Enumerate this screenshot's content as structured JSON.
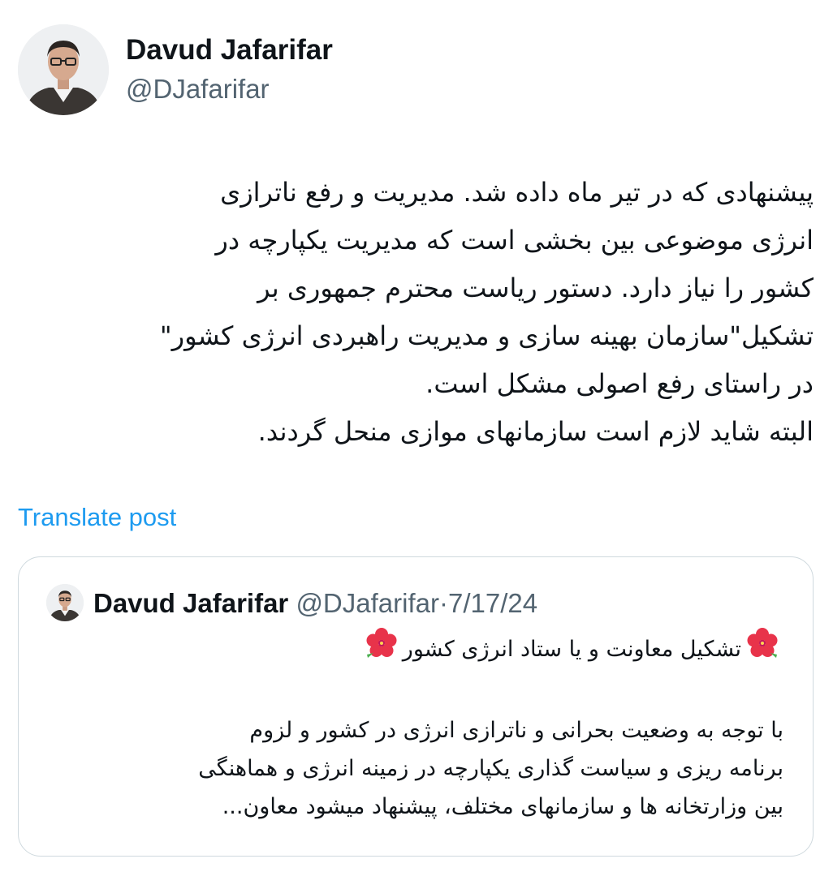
{
  "author": {
    "display_name": "Davud Jafarifar",
    "handle": "@DJafarifar"
  },
  "post": {
    "lines": [
      "پیشنهادی که در  تیر ماه داده شد. مدیریت و رفع ناترازی",
      "انرژی موضوعی بین بخشی است که مدیریت یکپارچه در",
      "کشور را نیاز دارد. دستور ریاست محترم جمهوری بر",
      "تشکیل\"سازمان بهینه سازی و مدیریت راهبردی انرژی کشور\"",
      "در راستای رفع اصولی مشکل است.",
      "البته شاید لازم است سازمانهای موازی منحل گردند."
    ],
    "translate_label": "Translate post"
  },
  "quoted_post": {
    "display_name": "Davud Jafarifar",
    "handle": "@DJafarifar",
    "separator": "·",
    "date": "7/17/24",
    "title": "تشکیل معاونت  و یا ستاد انرژی کشور",
    "title_emoji": "hibiscus-flower-icon",
    "body_lines": [
      "با توجه به وضعیت بحرانی و ناترازی انرژی در کشور و  لزوم",
      "برنامه ریزی و سیاست گذاری یکپارچه در زمینه انرژی و هماهنگی",
      "بین وزارتخانه ها و سازمانهای مختلف، پیشنهاد میشود معاون..."
    ]
  },
  "colors": {
    "text": "#0f1419",
    "secondary_text": "#536471",
    "link": "#1d9bf0",
    "card_border": "#cfd9de"
  }
}
